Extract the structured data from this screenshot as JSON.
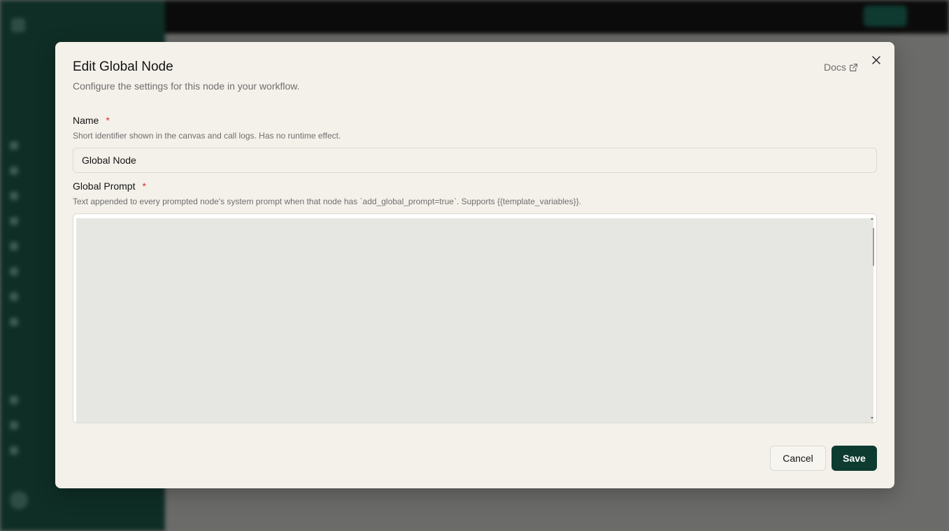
{
  "modal": {
    "title": "Edit Global Node",
    "subtitle": "Configure the settings for this node in your workflow.",
    "docs_label": "Docs",
    "close_icon": "close-icon",
    "external_link_icon": "external-link-icon"
  },
  "fields": {
    "name": {
      "label": "Name",
      "required_mark": "*",
      "help": "Short identifier shown in the canvas and call logs. Has no runtime effect.",
      "value": "Global Node"
    },
    "global_prompt": {
      "label": "Global Prompt",
      "required_mark": "*",
      "help": "Text appended to every prompted node's system prompt when that node has `add_global_prompt=true`. Supports {{template_variables}}.",
      "value": ""
    }
  },
  "actions": {
    "cancel_label": "Cancel",
    "save_label": "Save"
  },
  "colors": {
    "modal_background": "#f4f1ea",
    "primary_button": "#0d3b30",
    "required_mark": "#d3302f",
    "sidebar_background": "#0f2e26"
  }
}
